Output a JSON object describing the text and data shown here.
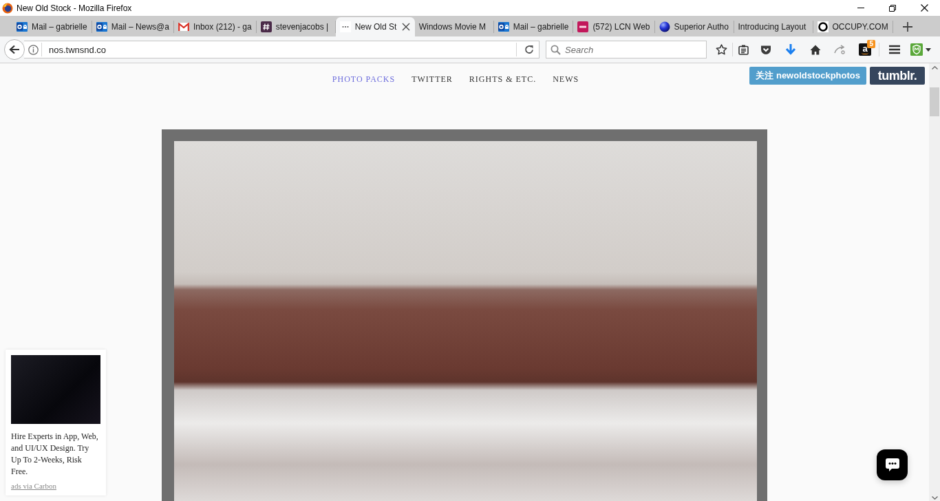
{
  "window": {
    "title": "New Old Stock - Mozilla Firefox"
  },
  "tabs": [
    {
      "label": "Mail – gabrielle",
      "kind": "outlook",
      "selected": false
    },
    {
      "label": "Mail – News@a",
      "kind": "outlook",
      "selected": false
    },
    {
      "label": "Inbox (212) - ga",
      "kind": "gmail",
      "selected": false
    },
    {
      "label": "stevenjacobs |",
      "kind": "slack",
      "selected": false
    },
    {
      "label": "New Old St",
      "kind": "loading",
      "selected": true
    },
    {
      "label": "Windows Movie M",
      "kind": "plain",
      "selected": false
    },
    {
      "label": "Mail – gabrielle",
      "kind": "outlook",
      "selected": false
    },
    {
      "label": "(572) LCN Web",
      "kind": "lcn",
      "selected": false
    },
    {
      "label": "Superior Autho",
      "kind": "sphere",
      "selected": false
    },
    {
      "label": "Introducing Layout",
      "kind": "plain",
      "selected": false
    },
    {
      "label": "OCCUPY.COM",
      "kind": "ring",
      "selected": false
    }
  ],
  "address_bar": {
    "url": "nos.twnsnd.co"
  },
  "search": {
    "placeholder": "Search"
  },
  "amazon_extension": {
    "logo": "a",
    "badge": "5"
  },
  "site_nav": [
    {
      "label": "PHOTO PACKS",
      "selected": true
    },
    {
      "label": "TWITTER",
      "selected": false
    },
    {
      "label": "RIGHTS & ETC.",
      "selected": false
    },
    {
      "label": "NEWS",
      "selected": false
    }
  ],
  "tumblr": {
    "follow_button": "关注 newoldstockphotos",
    "logo": "tumblr."
  },
  "carbon_ad": {
    "text": "Hire Experts in App, Web, and UI/UX Design. Try Up To 2-Weeks, Risk Free.",
    "credit": "ads via Carbon"
  }
}
